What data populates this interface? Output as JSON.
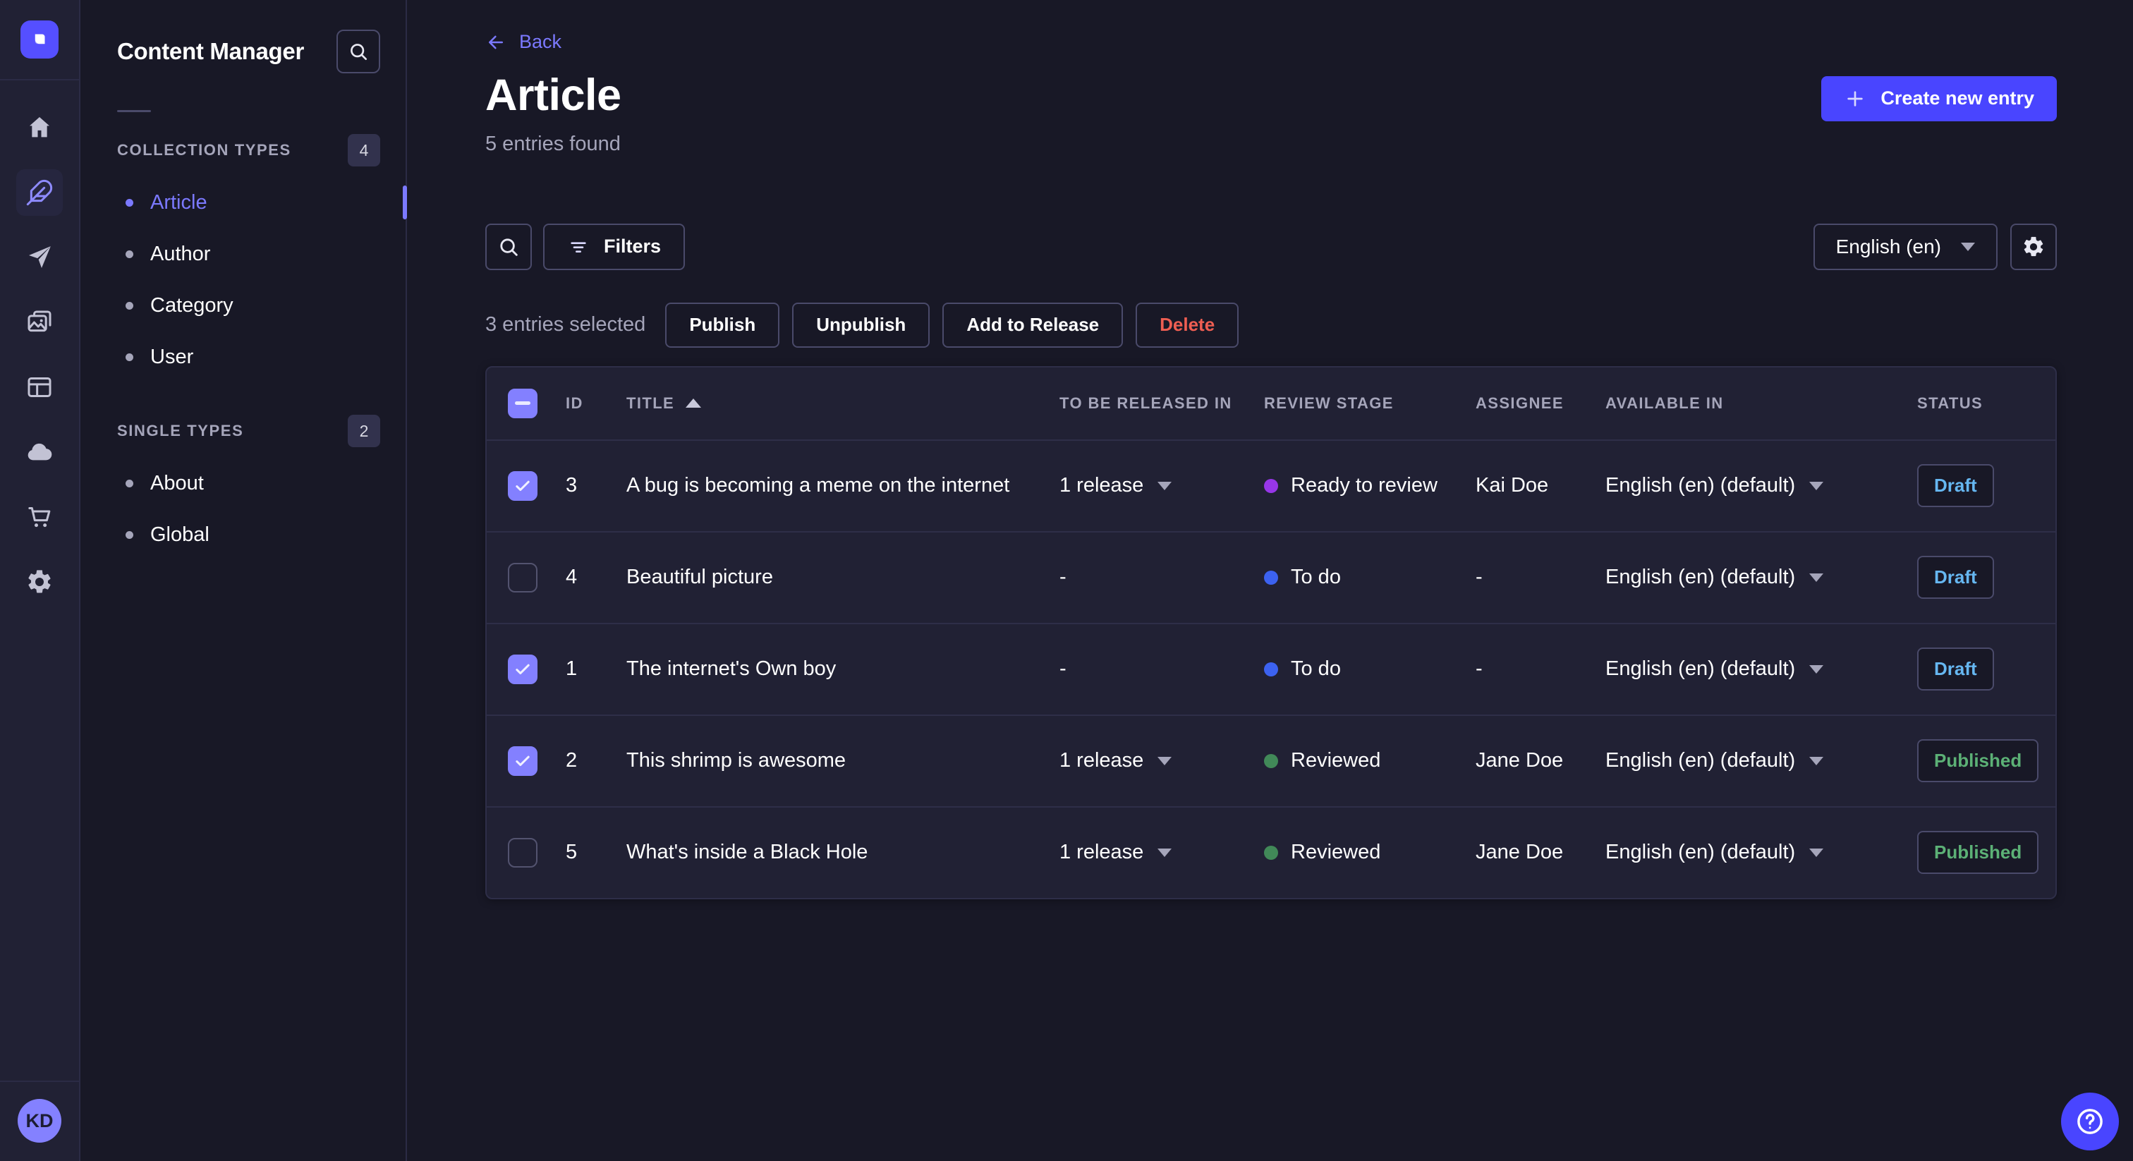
{
  "app": {
    "brand_color": "#4945ff"
  },
  "rail": {
    "items": [
      {
        "name": "home",
        "icon": "home-icon",
        "active": false
      },
      {
        "name": "content-manager",
        "icon": "feather-icon",
        "active": true
      },
      {
        "name": "releases",
        "icon": "paper-plane-icon",
        "active": false
      },
      {
        "name": "media-library",
        "icon": "images-icon",
        "active": false
      },
      {
        "name": "content-type-builder",
        "icon": "layout-icon",
        "active": false
      },
      {
        "name": "deploy",
        "icon": "cloud-icon",
        "active": false
      },
      {
        "name": "marketplace",
        "icon": "cart-icon",
        "active": false
      },
      {
        "name": "settings",
        "icon": "gear-icon",
        "active": false
      }
    ],
    "user_initials": "KD"
  },
  "subnav": {
    "title": "Content Manager",
    "sections": [
      {
        "label": "COLLECTION TYPES",
        "badge": "4",
        "items": [
          {
            "label": "Article",
            "active": true
          },
          {
            "label": "Author",
            "active": false
          },
          {
            "label": "Category",
            "active": false
          },
          {
            "label": "User",
            "active": false
          }
        ]
      },
      {
        "label": "SINGLE TYPES",
        "badge": "2",
        "items": [
          {
            "label": "About",
            "active": false
          },
          {
            "label": "Global",
            "active": false
          }
        ]
      }
    ]
  },
  "header": {
    "back_label": "Back",
    "title": "Article",
    "subtitle": "5 entries found",
    "create_button": "Create new entry"
  },
  "toolbar": {
    "filters_label": "Filters",
    "locale_selected": "English (en)"
  },
  "selection": {
    "text": "3 entries selected",
    "actions": [
      {
        "label": "Publish",
        "danger": false
      },
      {
        "label": "Unpublish",
        "danger": false
      },
      {
        "label": "Add to Release",
        "danger": false
      },
      {
        "label": "Delete",
        "danger": true
      }
    ]
  },
  "table": {
    "headers": {
      "id": "ID",
      "title": "TITLE",
      "release": "TO BE RELEASED IN",
      "stage": "REVIEW STAGE",
      "assignee": "ASSIGNEE",
      "available": "AVAILABLE IN",
      "status": "STATUS"
    },
    "sort": {
      "column": "TITLE",
      "direction": "asc"
    },
    "rows": [
      {
        "checked": true,
        "id": "3",
        "title": "A bug is becoming a meme on the internet",
        "release": "1 release",
        "stage": "Ready to review",
        "stage_color": "#9736e8",
        "assignee": "Kai Doe",
        "available": "English (en) (default)",
        "status": "Draft"
      },
      {
        "checked": false,
        "id": "4",
        "title": "Beautiful picture",
        "release": "-",
        "stage": "To do",
        "stage_color": "#3c62f0",
        "assignee": "-",
        "available": "English (en) (default)",
        "status": "Draft"
      },
      {
        "checked": true,
        "id": "1",
        "title": "The internet's Own boy",
        "release": "-",
        "stage": "To do",
        "stage_color": "#3c62f0",
        "assignee": "-",
        "available": "English (en) (default)",
        "status": "Draft"
      },
      {
        "checked": true,
        "id": "2",
        "title": "This shrimp is awesome",
        "release": "1 release",
        "stage": "Reviewed",
        "stage_color": "#418958",
        "assignee": "Jane Doe",
        "available": "English (en) (default)",
        "status": "Published"
      },
      {
        "checked": false,
        "id": "5",
        "title": "What's inside a Black Hole",
        "release": "1 release",
        "stage": "Reviewed",
        "stage_color": "#418958",
        "assignee": "Jane Doe",
        "available": "English (en) (default)",
        "status": "Published"
      }
    ]
  },
  "status_colors": {
    "draft": "#66b7f1",
    "published": "#5cb176"
  }
}
